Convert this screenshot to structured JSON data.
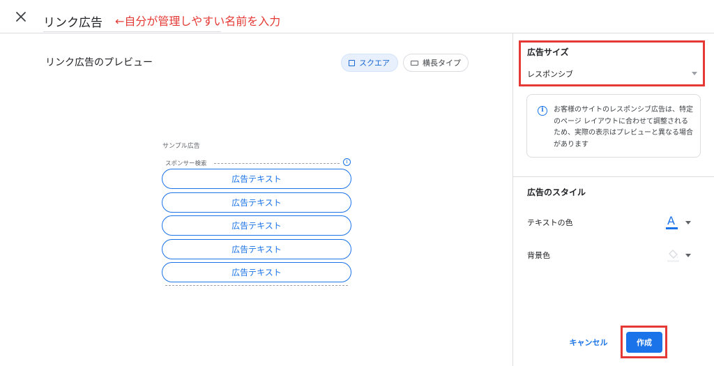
{
  "header": {
    "close_icon": "close-icon",
    "name_value": "リンク広告",
    "annotation": "←自分が管理しやすい名前を入力"
  },
  "preview": {
    "title": "リンク広告のプレビュー",
    "tabs": [
      {
        "label": "スクエア",
        "icon": "square-icon",
        "active": true
      },
      {
        "label": "横長タイプ",
        "icon": "landscape-icon",
        "active": false
      }
    ],
    "sample_label": "サンプル広告",
    "sponsor_label": "スポンサー検索",
    "ad_items": [
      "広告テキスト",
      "広告テキスト",
      "広告テキスト",
      "広告テキスト",
      "広告テキスト"
    ]
  },
  "settings": {
    "size_title": "広告サイズ",
    "size_value": "レスポンシブ",
    "info_text": "お客様のサイトのレスポンシブ広告は、特定のページ レイアウトに合わせて調整されるため、実際の表示はプレビューと異なる場合があります",
    "style_title": "広告のスタイル",
    "text_color_label": "テキストの色",
    "text_color_glyph": "A",
    "bg_color_label": "背景色"
  },
  "actions": {
    "cancel_label": "キャンセル",
    "create_label": "作成"
  },
  "colors": {
    "accent": "#1a73e8",
    "highlight_red": "#e53935"
  }
}
